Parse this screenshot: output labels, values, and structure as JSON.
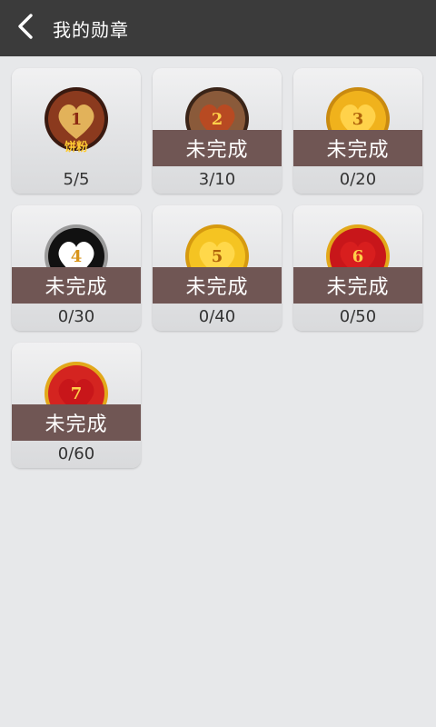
{
  "header": {
    "title": "我的勋章"
  },
  "badges": [
    {
      "number": "1",
      "caption": "饼粉",
      "progress": "5/5",
      "status": "",
      "rim": "#5a2a1a",
      "face": "#8b3a1e",
      "heart": "#e2b25a"
    },
    {
      "number": "2",
      "caption": "",
      "progress": "3/10",
      "status": "未完成",
      "rim": "#3a2418",
      "face": "#8a5a3a",
      "heart": "#b84a22"
    },
    {
      "number": "3",
      "caption": "",
      "progress": "0/20",
      "status": "未完成",
      "rim": "#c98a10",
      "face": "#f0b21c",
      "heart": "#ffd24a"
    },
    {
      "number": "4",
      "caption": "",
      "progress": "0/30",
      "status": "未完成",
      "rim": "#9a9a9a",
      "face": "#111111",
      "heart": "#ffffff"
    },
    {
      "number": "5",
      "caption": "",
      "progress": "0/40",
      "status": "未完成",
      "rim": "#d69a10",
      "face": "#f5c422",
      "heart": "#ffd84a"
    },
    {
      "number": "6",
      "caption": "",
      "progress": "0/50",
      "status": "未完成",
      "rim": "#e2a81a",
      "face": "#c8161a",
      "heart": "#d81e1e"
    },
    {
      "number": "7",
      "caption": "",
      "progress": "0/60",
      "status": "未完成",
      "rim": "#e2a81a",
      "face": "#d42420",
      "heart": "#c8161a"
    }
  ]
}
